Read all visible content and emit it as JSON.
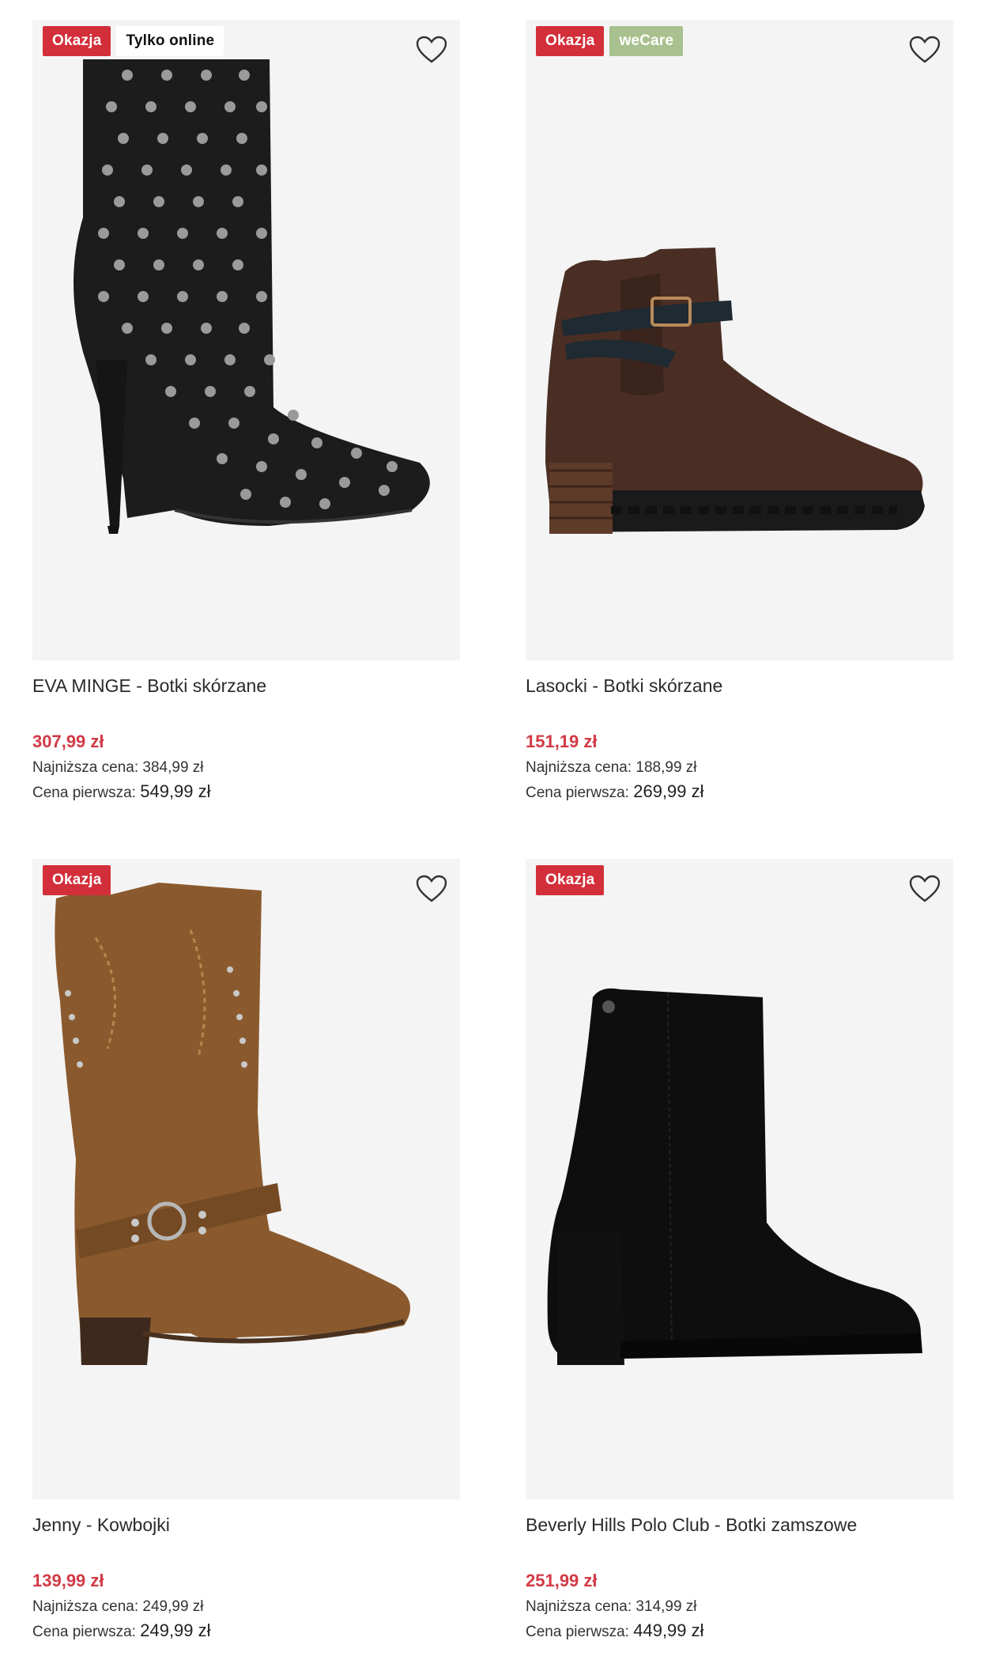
{
  "products": [
    {
      "badges": [
        {
          "label": "Okazja",
          "style": "red"
        },
        {
          "label": "Tylko online",
          "style": "white"
        }
      ],
      "name": "EVA MINGE - Botki skórzane",
      "price": "307,99 zł",
      "lowest_label": "Najniższa cena:",
      "lowest_value": "384,99 zł",
      "original_label": "Cena pierwsza:",
      "original_value": "549,99 zł",
      "image": "black-studded-heeled-ankle-boot"
    },
    {
      "badges": [
        {
          "label": "Okazja",
          "style": "red"
        },
        {
          "label": "weCare",
          "style": "green"
        }
      ],
      "name": "Lasocki - Botki skórzane",
      "price": "151,19 zł",
      "lowest_label": "Najniższa cena:",
      "lowest_value": "188,99 zł",
      "original_label": "Cena pierwsza:",
      "original_value": "269,99 zł",
      "image": "brown-leather-chelsea-boot-with-strap"
    },
    {
      "badges": [
        {
          "label": "Okazja",
          "style": "red"
        }
      ],
      "name": "Jenny - Kowbojki",
      "price": "139,99 zł",
      "lowest_label": "Najniższa cena:",
      "lowest_value": "249,99 zł",
      "original_label": "Cena pierwsza:",
      "original_value": "249,99 zł",
      "image": "tan-suede-cowboy-boot"
    },
    {
      "badges": [
        {
          "label": "Okazja",
          "style": "red"
        }
      ],
      "name": "Beverly Hills Polo Club - Botki zamszowe",
      "price": "251,99 zł",
      "lowest_label": "Najniższa cena:",
      "lowest_value": "314,99 zł",
      "original_label": "Cena pierwsza:",
      "original_value": "449,99 zł",
      "image": "black-suede-block-heel-ankle-boot"
    }
  ],
  "icons": {
    "favorite": "heart-outline-icon"
  },
  "colors": {
    "sale_red": "#d32f3a",
    "price_red": "#d23a45",
    "wecare_green": "#a9c18f",
    "image_bg": "#f4f4f4"
  }
}
